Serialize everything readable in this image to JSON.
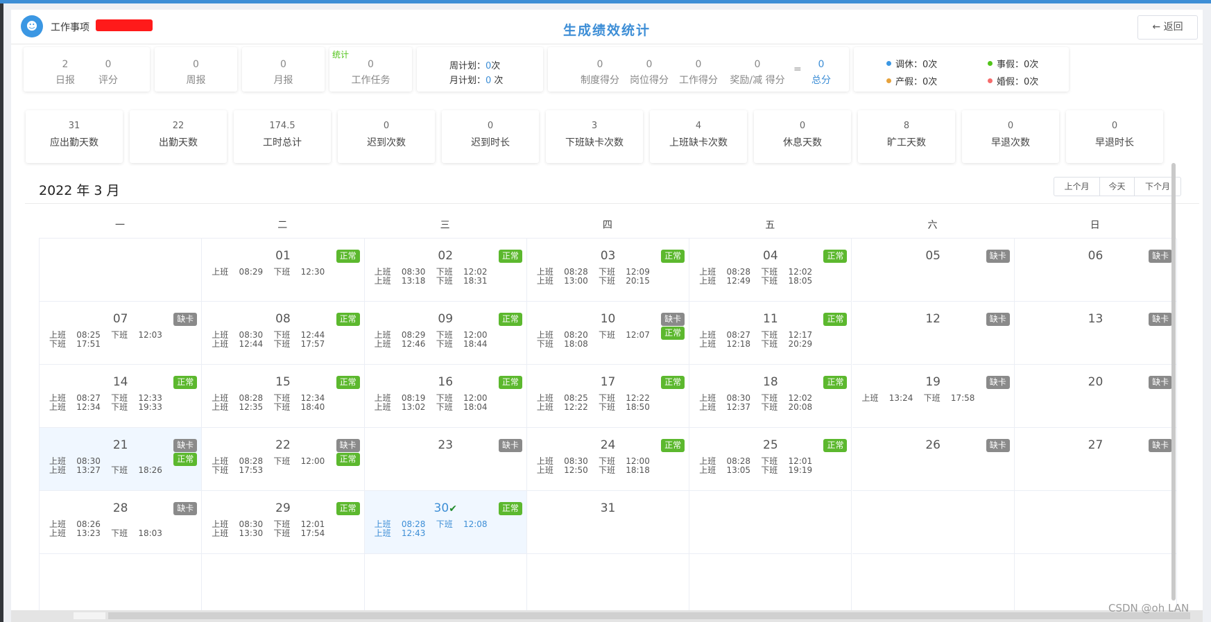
{
  "header": {
    "app_name": "工作事项",
    "title": "生成绩效统计",
    "back_label": "← 返回"
  },
  "reports": {
    "daily": {
      "value": "2",
      "label": "日报"
    },
    "score": {
      "value": "0",
      "label": "评分"
    },
    "weekly": {
      "value": "0",
      "label": "周报"
    },
    "monthly": {
      "value": "0",
      "label": "月报"
    },
    "stats_label": "统计",
    "tasks": {
      "value": "0",
      "label": "工作任务"
    }
  },
  "plans": {
    "week_label": "周计划：",
    "week_value": "0",
    "week_unit": "次",
    "month_label": "月计划：",
    "month_value": "0",
    "month_unit": " 次"
  },
  "scores": {
    "system": {
      "value": "0",
      "label": "制度得分"
    },
    "position": {
      "value": "0",
      "label": "岗位得分"
    },
    "work": {
      "value": "0",
      "label": "工作得分"
    },
    "bonus": {
      "value": "0",
      "label": "奖励/减 得分"
    },
    "equals": "=",
    "total": {
      "value": "0",
      "label": "总分"
    }
  },
  "leaves": [
    {
      "name": "调休：",
      "value": "0次",
      "color": "#3b97e3"
    },
    {
      "name": "事假：",
      "value": "0次",
      "color": "#52c41a"
    },
    {
      "name": "产假：",
      "value": "0次",
      "color": "#e6a23c"
    },
    {
      "name": "婚假：",
      "value": "0次",
      "color": "#f56c6c"
    }
  ],
  "attendance": [
    {
      "value": "31",
      "label": "应出勤天数"
    },
    {
      "value": "22",
      "label": "出勤天数"
    },
    {
      "value": "174.5",
      "label": "工时总计"
    },
    {
      "value": "0",
      "label": "迟到次数"
    },
    {
      "value": "0",
      "label": "迟到时长"
    },
    {
      "value": "3",
      "label": "下班缺卡次数"
    },
    {
      "value": "4",
      "label": "上班缺卡次数"
    },
    {
      "value": "0",
      "label": "休息天数"
    },
    {
      "value": "8",
      "label": "旷工天数"
    },
    {
      "value": "0",
      "label": "早退次数"
    },
    {
      "value": "0",
      "label": "早退时长"
    }
  ],
  "calendar": {
    "month_title": "2022 年 3 月",
    "nav": {
      "prev": "上个月",
      "today": "今天",
      "next": "下个月"
    },
    "weekdays": [
      "一",
      "二",
      "三",
      "四",
      "五",
      "六",
      "日"
    ],
    "status_labels": {
      "ok": "正常",
      "miss": "缺卡"
    },
    "days": [
      {
        "day": "01",
        "col": 1,
        "row": 0,
        "badges": [
          "ok"
        ],
        "lines": [
          "上班    08:29    下班    12:30"
        ]
      },
      {
        "day": "02",
        "col": 2,
        "row": 0,
        "badges": [
          "ok"
        ],
        "lines": [
          "上班    08:30    下班    12:02",
          "上班    13:18    下班    18:31"
        ]
      },
      {
        "day": "03",
        "col": 3,
        "row": 0,
        "badges": [
          "ok"
        ],
        "lines": [
          "上班    08:28    下班    12:09",
          "上班    13:00    下班    20:15"
        ]
      },
      {
        "day": "04",
        "col": 4,
        "row": 0,
        "badges": [
          "ok"
        ],
        "lines": [
          "上班    08:28    下班    12:02",
          "上班    12:49    下班    18:05"
        ]
      },
      {
        "day": "05",
        "col": 5,
        "row": 0,
        "badges": [
          "miss"
        ],
        "lines": []
      },
      {
        "day": "06",
        "col": 6,
        "row": 0,
        "badges": [
          "miss"
        ],
        "lines": []
      },
      {
        "day": "07",
        "col": 0,
        "row": 1,
        "badges": [
          "miss"
        ],
        "lines": [
          "上班    08:25    下班    12:03",
          "下班    17:51"
        ]
      },
      {
        "day": "08",
        "col": 1,
        "row": 1,
        "badges": [
          "ok"
        ],
        "lines": [
          "上班    08:30    下班    12:44",
          "上班    12:44    下班    17:57"
        ]
      },
      {
        "day": "09",
        "col": 2,
        "row": 1,
        "badges": [
          "ok"
        ],
        "lines": [
          "上班    08:29    下班    12:00",
          "上班    12:46    下班    18:44"
        ]
      },
      {
        "day": "10",
        "col": 3,
        "row": 1,
        "badges": [
          "miss",
          "ok"
        ],
        "lines": [
          "上班    08:20    下班    12:07",
          "下班    18:08"
        ]
      },
      {
        "day": "11",
        "col": 4,
        "row": 1,
        "badges": [
          "ok"
        ],
        "lines": [
          "上班    08:27    下班    12:17",
          "上班    12:18    下班    20:29"
        ]
      },
      {
        "day": "12",
        "col": 5,
        "row": 1,
        "badges": [
          "miss"
        ],
        "lines": []
      },
      {
        "day": "13",
        "col": 6,
        "row": 1,
        "badges": [
          "miss"
        ],
        "lines": []
      },
      {
        "day": "14",
        "col": 0,
        "row": 2,
        "badges": [
          "ok"
        ],
        "lines": [
          "上班    08:27    下班    12:33",
          "上班    12:34    下班    19:33"
        ]
      },
      {
        "day": "15",
        "col": 1,
        "row": 2,
        "badges": [
          "ok"
        ],
        "lines": [
          "上班    08:28    下班    12:34",
          "上班    12:35    下班    18:40"
        ]
      },
      {
        "day": "16",
        "col": 2,
        "row": 2,
        "badges": [
          "ok"
        ],
        "lines": [
          "上班    08:19    下班    12:00",
          "上班    13:02    下班    18:04"
        ]
      },
      {
        "day": "17",
        "col": 3,
        "row": 2,
        "badges": [
          "ok"
        ],
        "lines": [
          "上班    08:25    下班    12:22",
          "上班    12:22    下班    18:50"
        ]
      },
      {
        "day": "18",
        "col": 4,
        "row": 2,
        "badges": [
          "ok"
        ],
        "lines": [
          "上班    08:30    下班    12:02",
          "上班    12:37    下班    20:08"
        ]
      },
      {
        "day": "19",
        "col": 5,
        "row": 2,
        "badges": [
          "miss"
        ],
        "lines": [
          "上班    13:24    下班    17:58"
        ]
      },
      {
        "day": "20",
        "col": 6,
        "row": 2,
        "badges": [
          "miss"
        ],
        "lines": []
      },
      {
        "day": "21",
        "col": 0,
        "row": 3,
        "badges": [
          "miss",
          "ok"
        ],
        "lines": [
          "上班    08:30",
          "上班    13:27    下班    18:26"
        ],
        "highlight": true
      },
      {
        "day": "22",
        "col": 1,
        "row": 3,
        "badges": [
          "miss",
          "ok"
        ],
        "lines": [
          "上班    08:28    下班    12:00",
          "下班    17:53"
        ]
      },
      {
        "day": "23",
        "col": 2,
        "row": 3,
        "badges": [
          "miss"
        ],
        "lines": []
      },
      {
        "day": "24",
        "col": 3,
        "row": 3,
        "badges": [
          "ok"
        ],
        "lines": [
          "上班    08:30    下班    12:00",
          "上班    12:50    下班    18:18"
        ]
      },
      {
        "day": "25",
        "col": 4,
        "row": 3,
        "badges": [
          "ok"
        ],
        "lines": [
          "上班    08:28    下班    12:01",
          "上班    13:05    下班    19:19"
        ]
      },
      {
        "day": "26",
        "col": 5,
        "row": 3,
        "badges": [
          "miss"
        ],
        "lines": []
      },
      {
        "day": "27",
        "col": 6,
        "row": 3,
        "badges": [
          "miss"
        ],
        "lines": []
      },
      {
        "day": "28",
        "col": 0,
        "row": 4,
        "badges": [
          "miss"
        ],
        "lines": [
          "上班    08:26",
          "上班    13:23    下班    18:03"
        ]
      },
      {
        "day": "29",
        "col": 1,
        "row": 4,
        "badges": [
          "ok"
        ],
        "lines": [
          "上班    08:30    下班    12:01",
          "上班    13:30    下班    17:54"
        ]
      },
      {
        "day": "30",
        "col": 2,
        "row": 4,
        "badges": [
          "ok"
        ],
        "lines": [
          "上班    08:28    下班    12:08",
          "上班    12:43"
        ],
        "highlight": true,
        "today": true
      },
      {
        "day": "31",
        "col": 3,
        "row": 4,
        "badges": [],
        "lines": []
      }
    ]
  },
  "watermark": "CSDN @oh LAN"
}
